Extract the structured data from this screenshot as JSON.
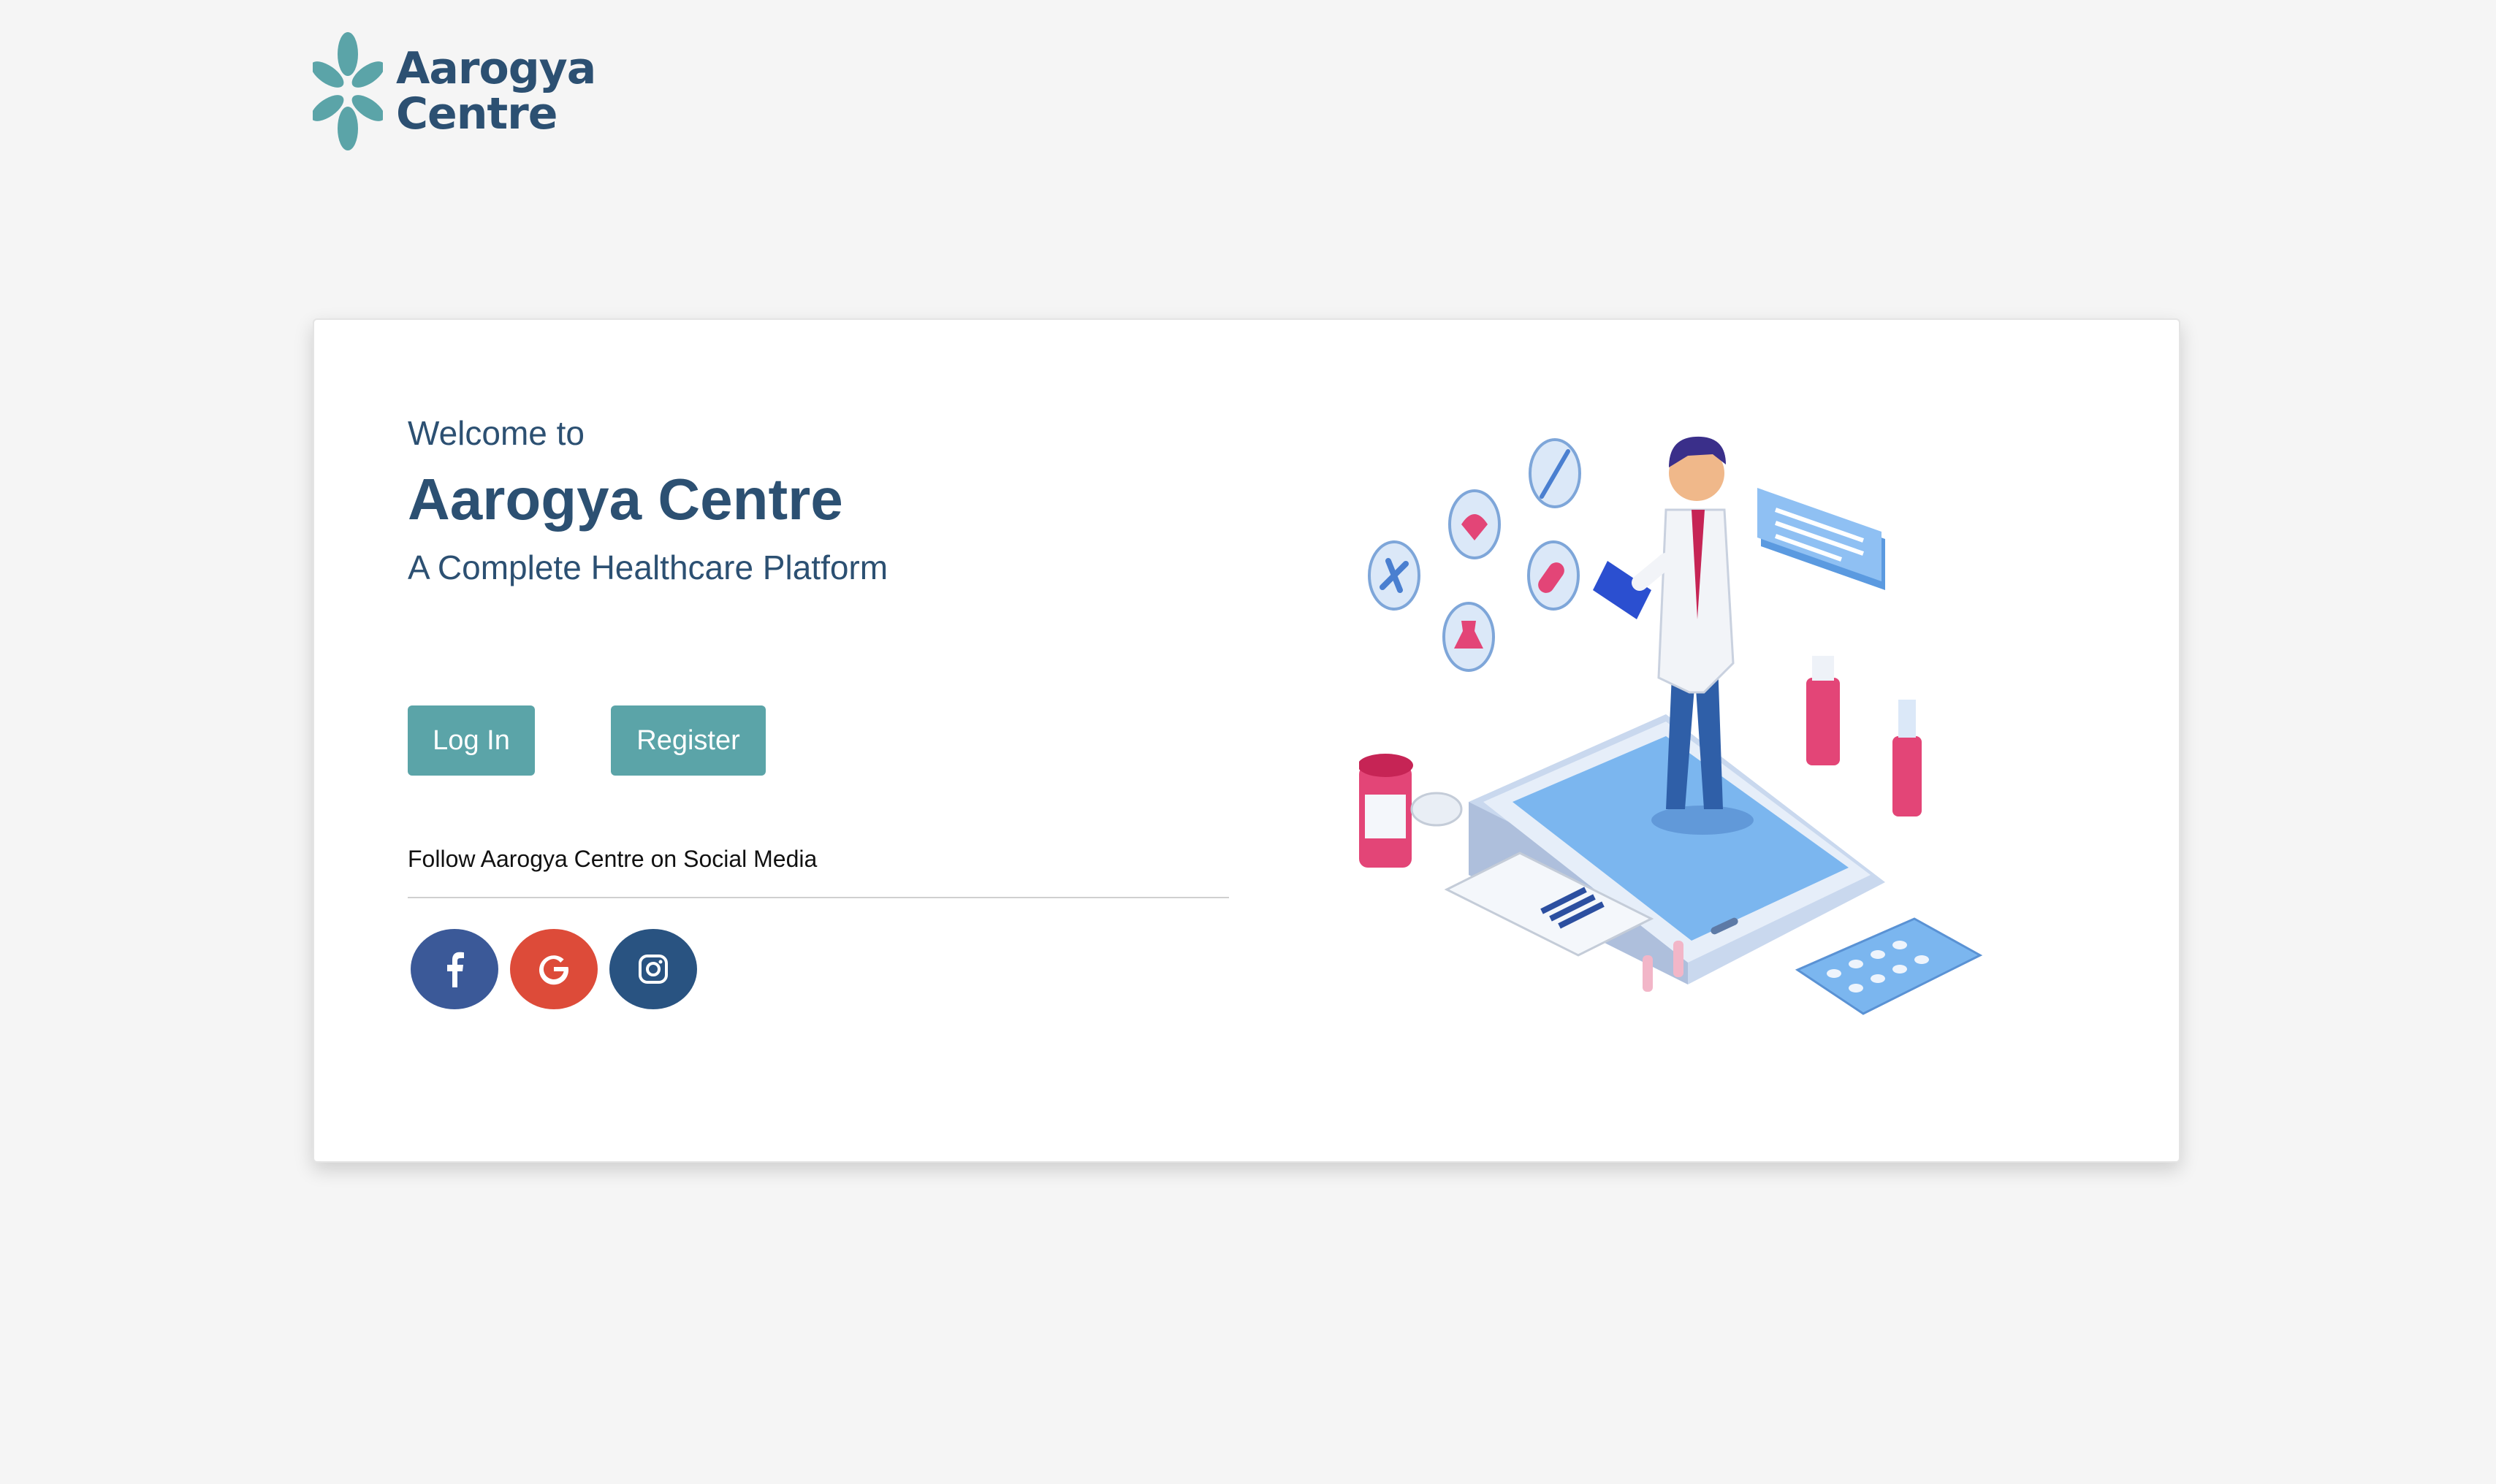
{
  "brand": {
    "line1": "Aarogya",
    "line2": "Centre",
    "logo_icon": "leaf-flower-icon",
    "primary_color": "#2c5072",
    "accent_color": "#5ba4a8"
  },
  "hero": {
    "welcome": "Welcome to",
    "title": "Aarogya Centre",
    "tagline": "A Complete Healthcare Platform"
  },
  "actions": {
    "login_label": "Log In",
    "register_label": "Register"
  },
  "social": {
    "heading": "Follow Aarogya Centre on Social Media",
    "items": [
      {
        "icon": "facebook-icon",
        "color": "#3b5998"
      },
      {
        "icon": "google-icon",
        "color": "#dd4b39"
      },
      {
        "icon": "instagram-icon",
        "color": "#295381"
      }
    ]
  },
  "illustration": {
    "subject": "doctor-on-smartphone-illustration"
  }
}
